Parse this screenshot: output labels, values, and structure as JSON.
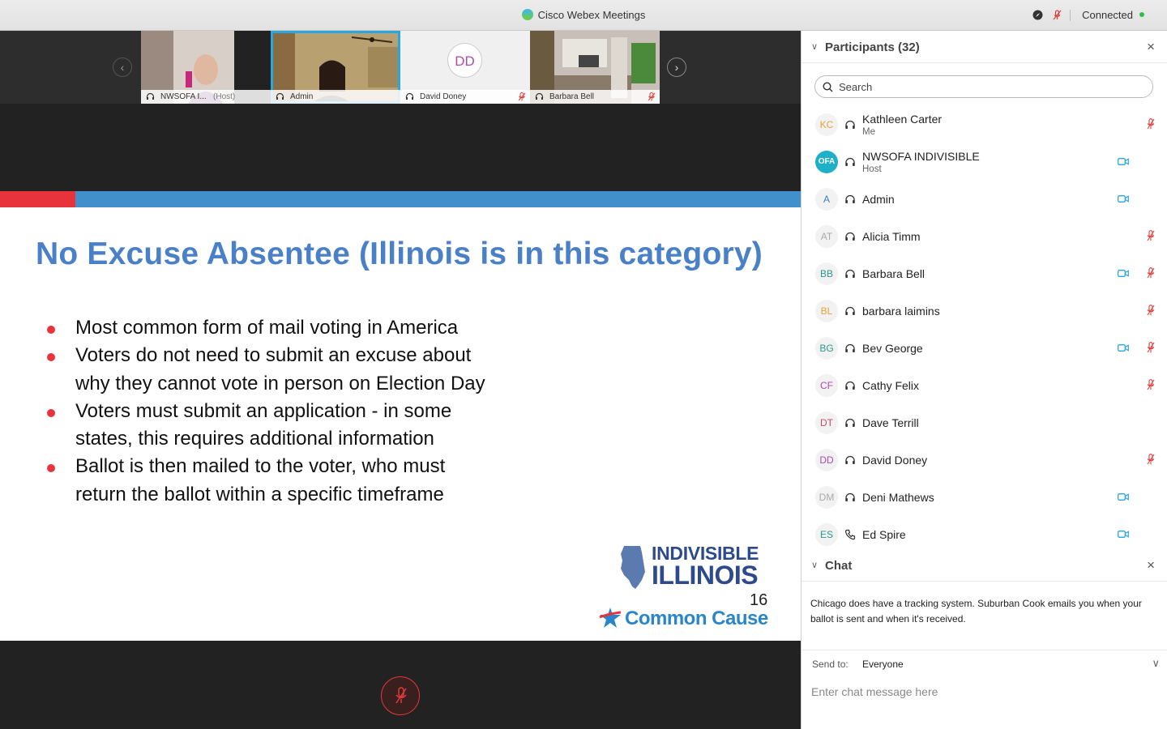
{
  "window": {
    "title": "Cisco Webex Meetings",
    "connection_status": "Connected"
  },
  "thumbnails": [
    {
      "name": "NWSOFA I...",
      "role": "(Host)",
      "muted": false,
      "active": false
    },
    {
      "name": "Admin",
      "role": "",
      "muted": false,
      "active": true
    },
    {
      "name": "David Doney",
      "initials": "DD",
      "muted": true,
      "active": false
    },
    {
      "name": "Barbara Bell",
      "muted": true,
      "active": false
    }
  ],
  "slide": {
    "heading": "No Excuse Absentee (Illinois is in this category)",
    "bullets": [
      "Most common form of mail voting in America",
      "Voters do not need to submit an excuse about why they cannot vote in person on Election Day",
      "Voters must submit an application - in some states, this requires additional information",
      "Ballot is then mailed to the voter, who must return the ballot within a specific timeframe"
    ],
    "logo_line1": "INDIVISIBLE",
    "logo_line2": "ILLINOIS",
    "page_number": "16",
    "logo2": "Common Cause"
  },
  "participants": {
    "title": "Participants (32)",
    "search_placeholder": "Search",
    "list": [
      {
        "initials": "KC",
        "color": "#e8a23a",
        "name": "Kathleen Carter",
        "sub": "Me",
        "audio": "headset",
        "video": false,
        "muted": true
      },
      {
        "initials": "OFA",
        "color": "#ffffff",
        "name": "NWSOFA INDIVISIBLE",
        "sub": "Host",
        "audio": "headset",
        "video": true,
        "muted": false
      },
      {
        "initials": "A",
        "color": "#3a7fc4",
        "name": "Admin",
        "sub": "",
        "audio": "headset",
        "video": true,
        "muted": false
      },
      {
        "initials": "AT",
        "color": "#aaaaaa",
        "name": "Alicia Timm",
        "sub": "",
        "audio": "headset",
        "video": false,
        "muted": true
      },
      {
        "initials": "BB",
        "color": "#2a9a8a",
        "name": "Barbara Bell",
        "sub": "",
        "audio": "headset",
        "video": true,
        "muted": true
      },
      {
        "initials": "BL",
        "color": "#e8a23a",
        "name": "barbara laimins",
        "sub": "",
        "audio": "headset",
        "video": false,
        "muted": true
      },
      {
        "initials": "BG",
        "color": "#2a9a8a",
        "name": "Bev George",
        "sub": "",
        "audio": "headset",
        "video": true,
        "muted": true
      },
      {
        "initials": "CF",
        "color": "#b04ab0",
        "name": "Cathy Felix",
        "sub": "",
        "audio": "headset",
        "video": false,
        "muted": true
      },
      {
        "initials": "DT",
        "color": "#c84a6a",
        "name": "Dave Terrill",
        "sub": "",
        "audio": "headset",
        "video": false,
        "muted": false
      },
      {
        "initials": "DD",
        "color": "#b04ab0",
        "name": "David Doney",
        "sub": "",
        "audio": "headset",
        "video": false,
        "muted": true
      },
      {
        "initials": "DM",
        "color": "#aaaaaa",
        "name": "Deni Mathews",
        "sub": "",
        "audio": "headset",
        "video": true,
        "muted": false
      },
      {
        "initials": "ES",
        "color": "#2a9a8a",
        "name": "Ed Spire",
        "sub": "",
        "audio": "phone",
        "video": true,
        "muted": false
      }
    ]
  },
  "chat": {
    "title": "Chat",
    "message": "Chicago does have a tracking system. Suburban Cook emails you when your ballot is sent and when it's received.",
    "send_to_label": "Send to:",
    "send_to_value": "Everyone",
    "input_placeholder": "Enter chat message here"
  },
  "colors": {
    "accent_blue": "#29a8e0",
    "slide_heading": "#4a80c8",
    "bullet_red": "#e8323c",
    "mute_red": "#e03a3a",
    "video_blue": "#29a8e0"
  }
}
